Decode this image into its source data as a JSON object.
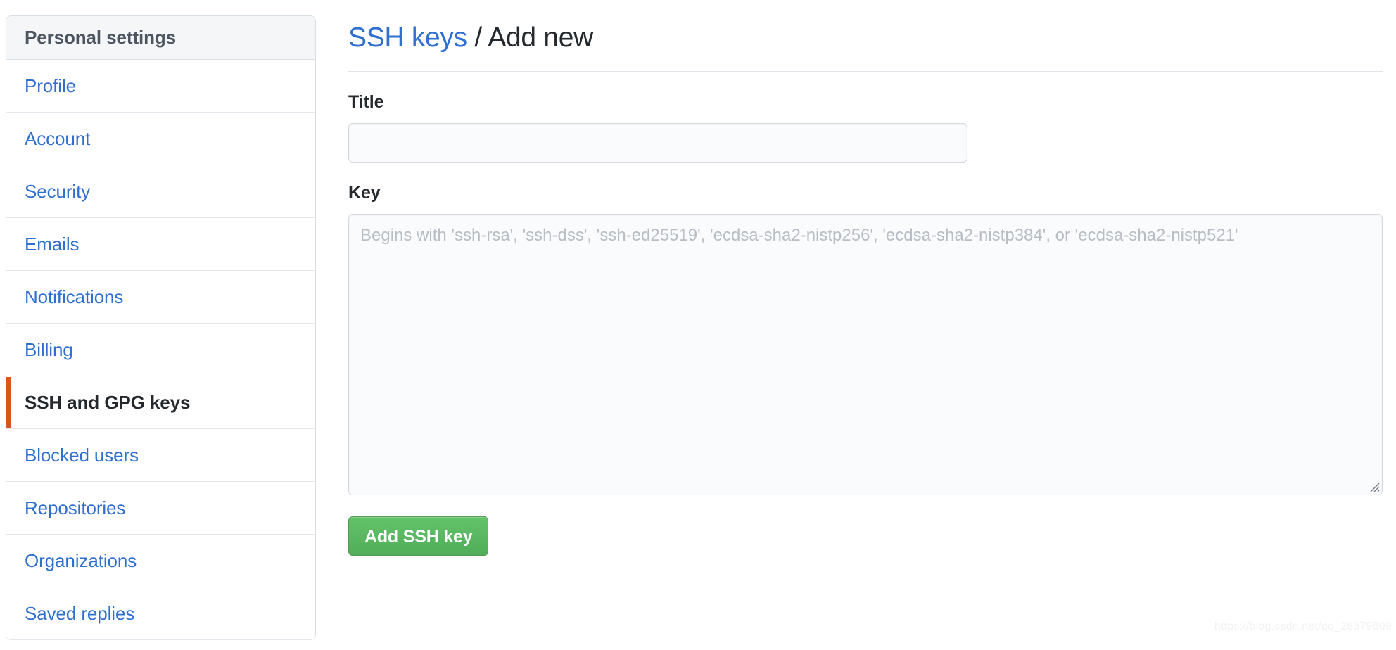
{
  "sidebar": {
    "header": "Personal settings",
    "items": [
      {
        "label": "Profile",
        "active": false
      },
      {
        "label": "Account",
        "active": false
      },
      {
        "label": "Security",
        "active": false
      },
      {
        "label": "Emails",
        "active": false
      },
      {
        "label": "Notifications",
        "active": false
      },
      {
        "label": "Billing",
        "active": false
      },
      {
        "label": "SSH and GPG keys",
        "active": true
      },
      {
        "label": "Blocked users",
        "active": false
      },
      {
        "label": "Repositories",
        "active": false
      },
      {
        "label": "Organizations",
        "active": false
      },
      {
        "label": "Saved replies",
        "active": false
      }
    ]
  },
  "main": {
    "breadcrumb_link": "SSH keys",
    "breadcrumb_separator": " / ",
    "breadcrumb_current": "Add new",
    "title_field": {
      "label": "Title",
      "value": "",
      "placeholder": ""
    },
    "key_field": {
      "label": "Key",
      "value": "",
      "placeholder": "Begins with 'ssh-rsa', 'ssh-dss', 'ssh-ed25519', 'ecdsa-sha2-nistp256', 'ecdsa-sha2-nistp384', or 'ecdsa-sha2-nistp521'"
    },
    "submit_label": "Add SSH key"
  },
  "watermark": "https://blog.csdn.net/qq_28379809",
  "colors": {
    "link": "#2f6fd0",
    "active_accent": "#d9541e",
    "button_green": "#55b15c",
    "text": "#24292e",
    "border": "#d8dee4"
  }
}
